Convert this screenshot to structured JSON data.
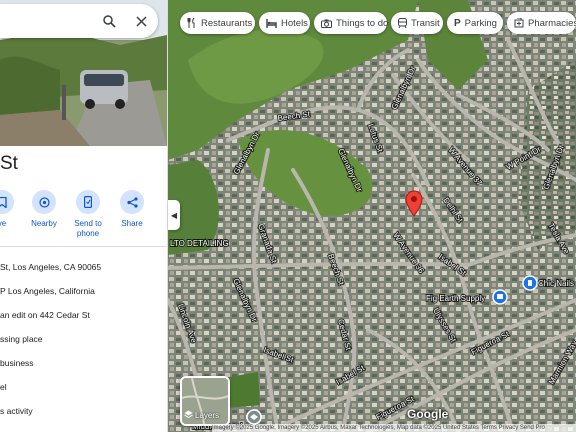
{
  "search": {
    "query": "",
    "search_icon": "search-icon",
    "close_icon": "close-icon"
  },
  "place": {
    "title": "St"
  },
  "actions": [
    {
      "label": "ve",
      "icon": "save-icon"
    },
    {
      "label": "Nearby",
      "icon": "nearby-icon"
    },
    {
      "label": "Send to phone",
      "icon": "phone-icon"
    },
    {
      "label": "Share",
      "icon": "share-icon"
    }
  ],
  "info": [
    {
      "text": "St, Los Angeles, CA 90065",
      "icon": "location-pin-icon"
    },
    {
      "text": "P Los Angeles, California",
      "icon": "plus-code-icon"
    },
    {
      "text": "an edit on 442 Cedar St",
      "icon": "edit-icon"
    },
    {
      "text": "ssing place",
      "icon": "add-place-icon"
    },
    {
      "text": "business",
      "icon": "business-icon"
    },
    {
      "text": "el",
      "icon": "label-icon"
    },
    {
      "text": "s activity",
      "icon": "activity-icon"
    }
  ],
  "chips": [
    {
      "label": "Restaurants",
      "icon": "restaurant-icon"
    },
    {
      "label": "Hotels",
      "icon": "hotel-icon"
    },
    {
      "label": "Things to do",
      "icon": "camera-icon"
    },
    {
      "label": "Transit",
      "icon": "transit-icon"
    },
    {
      "label": "Parking",
      "icon": "parking-icon"
    },
    {
      "label": "Pharmacies",
      "icon": "pharmacy-icon"
    }
  ],
  "map": {
    "streets": [
      "Beech St",
      "Lotus St",
      "Glenalbyn Dr",
      "Glenalbyn Dr",
      "W Avenue 37",
      "W Point Dr",
      "Glenalbyn Dr",
      "Delhi St",
      "Tesla Ave",
      "Granada St",
      "W Avenue 36",
      "Isabel St",
      "Isabel St",
      "Beech St",
      "Glenalbyn Dr",
      "Lincoln Ave",
      "Cedar St",
      "Isabel St",
      "Figueroa St",
      "Figueroa St",
      "Ulysses St",
      "Glenalbyn Dr",
      "Marmion Way"
    ],
    "places": [
      "LTO DETAILING",
      "Fig Earth Supply",
      "Chic Nails",
      "Middle School"
    ]
  },
  "layers": {
    "label": "Layers",
    "icon": "layers-icon"
  },
  "logo": "Google",
  "attribution": "Imagery ©2025 Google, Imagery ©2025 Airbus, Maxar Technologies, Map data ©2025    United States   Terms   Privacy   Send Pro",
  "colors": {
    "accent": "#0b57d0",
    "chip_bg": "#ffffff",
    "pin": "#ea4335",
    "action_circle": "#d3e3fd"
  }
}
